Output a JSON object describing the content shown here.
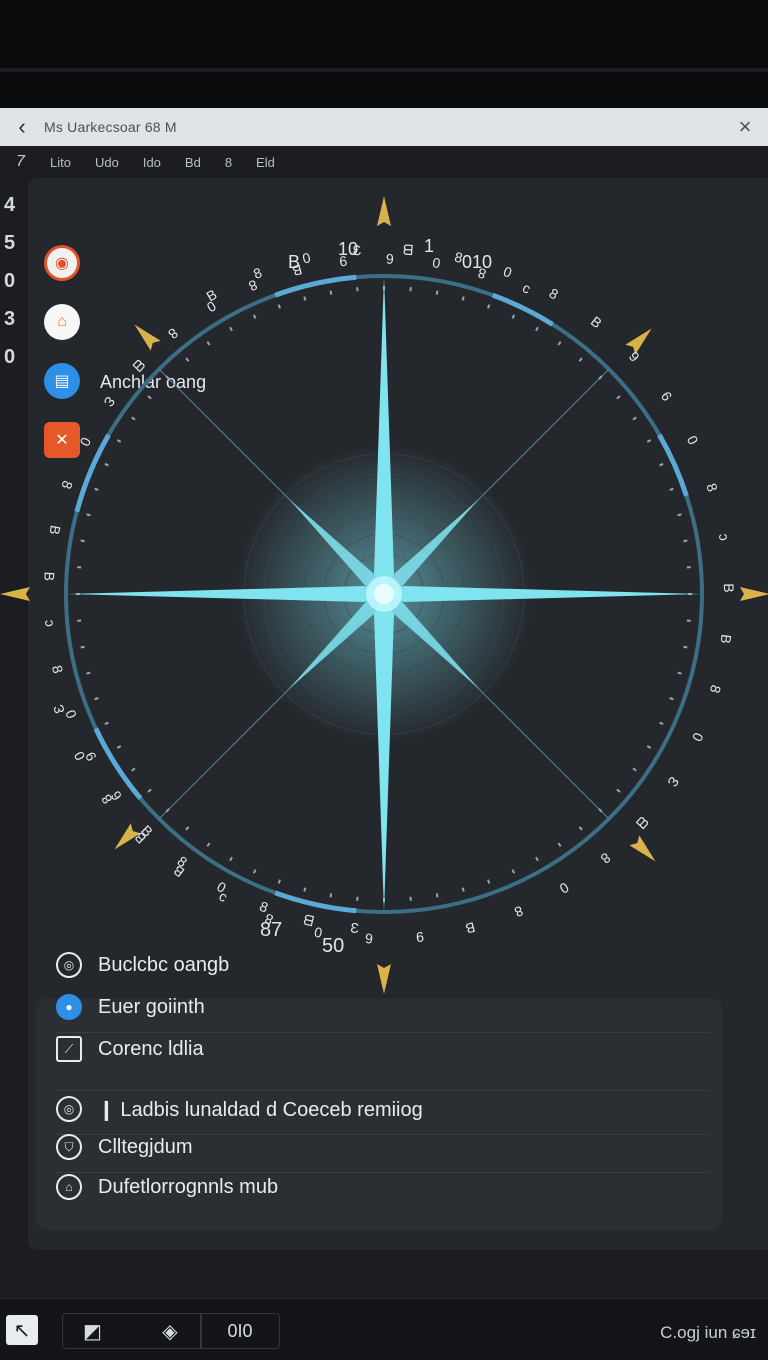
{
  "window": {
    "title": "Ms Uarkecsoar 68 M",
    "back_icon": "back-arrow-icon",
    "close_label": "×"
  },
  "tabs": {
    "number": "7",
    "items": [
      "Lito",
      "Udo",
      "Ido",
      "Bd",
      "8",
      "Eld"
    ]
  },
  "left_numbers": [
    "4",
    "5",
    "0",
    "3",
    "0"
  ],
  "sidebar_apps": [
    {
      "icon": "red-ring-app-icon",
      "glyph": "◉"
    },
    {
      "icon": "orange-home-app-icon",
      "glyph": "⌂"
    },
    {
      "icon": "blue-printer-app-icon",
      "glyph": "▤"
    },
    {
      "icon": "orange-tools-app-icon",
      "glyph": "✕"
    }
  ],
  "app_label": "Anchlar  oang",
  "compass": {
    "top_labels": [
      "10",
      "B",
      "1",
      "010"
    ],
    "bottom_labels": [
      "87",
      "50"
    ],
    "accent": "#7fe3f0",
    "ring": "#3c6f86",
    "marker": "#d9b24a"
  },
  "list": [
    {
      "icon": "circle-outline-icon",
      "label": "Buclcbc oangb"
    },
    {
      "icon": "blue-dot-icon",
      "label": "Euer goiinth"
    },
    {
      "icon": "chart-square-icon",
      "label": "Corenc ldlia"
    },
    {
      "icon": "circle-outline-icon",
      "label": "❙ Ladbis lunaldad d  Coeceb remiiog"
    },
    {
      "icon": "shield-outline-icon",
      "label": "Clltegjdum"
    },
    {
      "icon": "home-outline-icon",
      "label": "Dufetlorrognnls mub"
    }
  ],
  "bottom_bar": {
    "btn1": "↖",
    "btn2": "◩",
    "btn3": "◈",
    "btn4": "0I0",
    "right_text": "C.ogj iun  ɕɘɪ"
  }
}
